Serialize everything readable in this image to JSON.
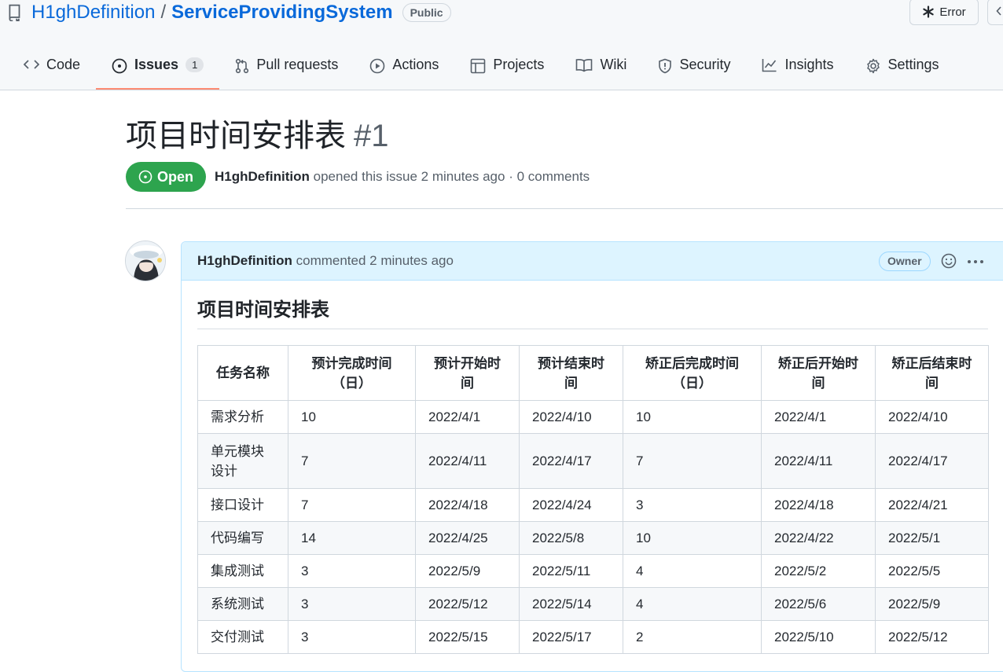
{
  "repo": {
    "owner": "H1ghDefinition",
    "separator": "/",
    "name": "ServiceProvidingSystem",
    "visibility": "Public",
    "error_button": "Error"
  },
  "nav": {
    "tabs": [
      {
        "label": "Code",
        "icon": "code-icon"
      },
      {
        "label": "Issues",
        "icon": "issue-opened-icon",
        "count": "1",
        "active": true
      },
      {
        "label": "Pull requests",
        "icon": "git-pull-request-icon"
      },
      {
        "label": "Actions",
        "icon": "play-icon"
      },
      {
        "label": "Projects",
        "icon": "table-icon"
      },
      {
        "label": "Wiki",
        "icon": "book-icon"
      },
      {
        "label": "Security",
        "icon": "shield-icon"
      },
      {
        "label": "Insights",
        "icon": "graph-icon"
      },
      {
        "label": "Settings",
        "icon": "gear-icon"
      }
    ]
  },
  "issue": {
    "title": "项目时间安排表",
    "number": "#1",
    "state": "Open",
    "author": "H1ghDefinition",
    "meta_text": "opened this issue 2 minutes ago · 0 comments"
  },
  "comment": {
    "author": "H1ghDefinition",
    "action_text": "commented 2 minutes ago",
    "role_badge": "Owner",
    "heading": "项目时间安排表",
    "table": {
      "headers": [
        "任务名称",
        "预计完成时间（日）",
        "预计开始时间",
        "预计结束时间",
        "矫正后完成时间（日）",
        "矫正后开始时间",
        "矫正后结束时间"
      ],
      "rows": [
        [
          "需求分析",
          "10",
          "2022/4/1",
          "2022/4/10",
          "10",
          "2022/4/1",
          "2022/4/10"
        ],
        [
          "单元模块设计",
          "7",
          "2022/4/11",
          "2022/4/17",
          "7",
          "2022/4/11",
          "2022/4/17"
        ],
        [
          "接口设计",
          "7",
          "2022/4/18",
          "2022/4/24",
          "3",
          "2022/4/18",
          "2022/4/21"
        ],
        [
          "代码编写",
          "14",
          "2022/4/25",
          "2022/5/8",
          "10",
          "2022/4/22",
          "2022/5/1"
        ],
        [
          "集成测试",
          "3",
          "2022/5/9",
          "2022/5/11",
          "4",
          "2022/5/2",
          "2022/5/5"
        ],
        [
          "系统测试",
          "3",
          "2022/5/12",
          "2022/5/14",
          "4",
          "2022/5/6",
          "2022/5/9"
        ],
        [
          "交付测试",
          "3",
          "2022/5/15",
          "2022/5/17",
          "2",
          "2022/5/10",
          "2022/5/12"
        ]
      ]
    }
  },
  "colors": {
    "link": "#0969da",
    "open_state": "#2da44e",
    "active_tab_underline": "#fd8c73",
    "comment_header_bg": "#ddf4ff"
  }
}
